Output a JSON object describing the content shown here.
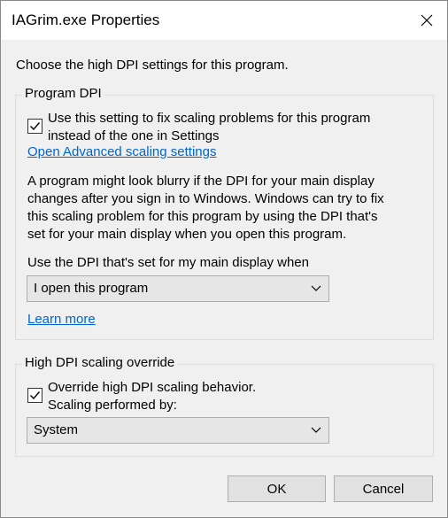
{
  "window": {
    "title": "IAGrim.exe Properties",
    "close_icon": "close-icon"
  },
  "intro": "Choose the high DPI settings for this program.",
  "program_dpi": {
    "label": "Program DPI",
    "checkbox_checked": true,
    "checkbox_line1": "Use this setting to fix scaling problems for this program",
    "checkbox_line2": "instead of the one in Settings",
    "advanced_link": "Open Advanced scaling settings",
    "desc_line1": "A program might look blurry if the DPI for your main display",
    "desc_line2": "changes after you sign in to Windows. Windows can try to fix",
    "desc_line3": "this scaling problem for this program by using the DPI that's",
    "desc_line4": "set for your main display when you open this program.",
    "dropdown_label": "Use the DPI that's set for my main display when",
    "dropdown_value": "I open this program",
    "learn_more": "Learn more"
  },
  "override": {
    "label": "High DPI scaling override",
    "checkbox_checked": true,
    "checkbox_line1": "Override high DPI scaling behavior.",
    "checkbox_line2": "Scaling performed by:",
    "dropdown_value": "System"
  },
  "buttons": {
    "ok": "OK",
    "cancel": "Cancel"
  },
  "colors": {
    "link": "#0066cc",
    "window_bg": "#f0f0f0",
    "titlebar_bg": "#ffffff"
  }
}
